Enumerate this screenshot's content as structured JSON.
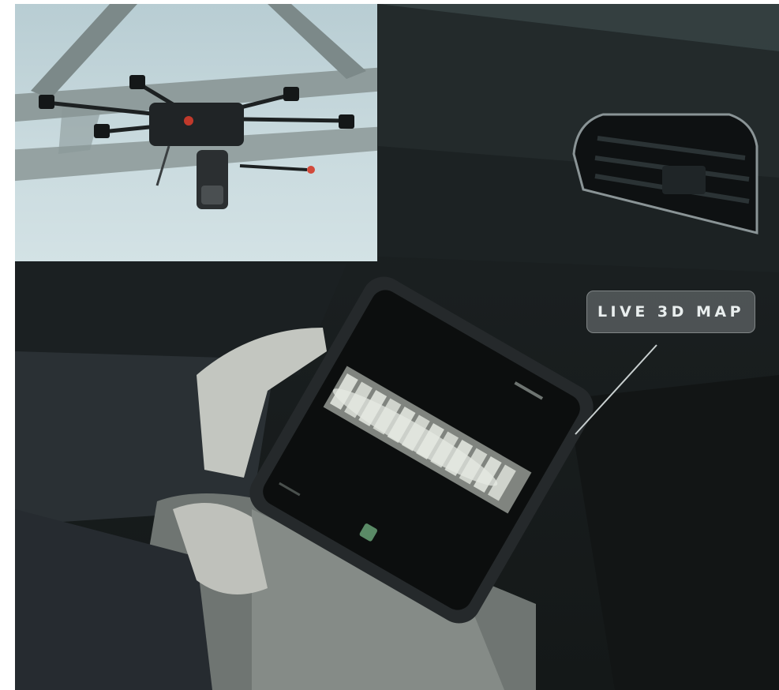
{
  "callout": {
    "label": "LIVE 3D MAP"
  },
  "colors": {
    "sky": "#c9dade",
    "cabin": "#1a1f20",
    "tablet_screen": "#0c0e0e",
    "map_points": "#c8ccc6",
    "callout_bg": "#787e80",
    "callout_text": "#e9eeee"
  }
}
